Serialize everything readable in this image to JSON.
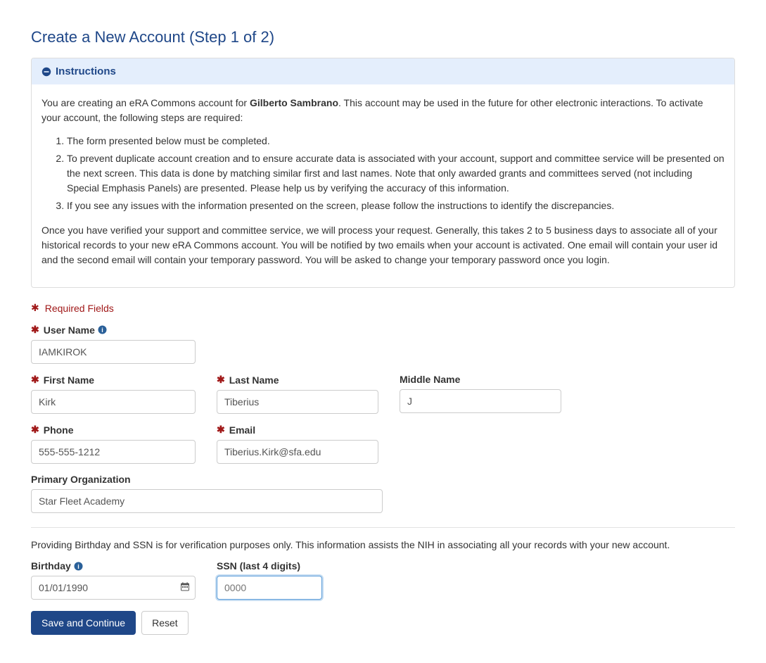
{
  "page_title": "Create a New Account (Step 1 of 2)",
  "instructions": {
    "header": "Instructions",
    "intro_prefix": "You are creating an eRA Commons account for ",
    "bold_name": "Gilberto Sambrano",
    "intro_suffix": ". This account may be used in the future for other electronic interactions. To activate your account, the following steps are required:",
    "steps": [
      "The form presented below must be completed.",
      "To prevent duplicate account creation and to ensure accurate data is associated with your account, support and committee service will be presented on the next screen. This data is done by matching similar first and last names. Note that only awarded grants and committees served (not including Special Emphasis Panels) are presented. Please help us by verifying the accuracy of this information.",
      "If you see any issues with the information presented on the screen, please follow the instructions to identify the discrepancies."
    ],
    "footer": "Once you have verified your support and committee service, we will process your request. Generally, this takes 2 to 5 business days to associate all of your historical records to your new eRA Commons account. You will be notified by two emails when your account is activated. One email will contain your user id and the second email will contain your temporary password. You will be asked to change your temporary password once you login."
  },
  "required_legend": "Required Fields",
  "fields": {
    "username": {
      "label": "User Name",
      "value": "IAMKIROK"
    },
    "first_name": {
      "label": "First Name",
      "value": "Kirk"
    },
    "last_name": {
      "label": "Last Name",
      "value": "Tiberius"
    },
    "middle_name": {
      "label": "Middle Name",
      "value": "J"
    },
    "phone": {
      "label": "Phone",
      "value": "555-555-1212"
    },
    "email": {
      "label": "Email",
      "value": "Tiberius.Kirk@sfa.edu"
    },
    "primary_org": {
      "label": "Primary Organization",
      "value": "Star Fleet Academy"
    },
    "birthday": {
      "label": "Birthday",
      "value": "01/01/1990"
    },
    "ssn": {
      "label": "SSN (last 4 digits)",
      "placeholder": "0000",
      "value": ""
    }
  },
  "verification_help": "Providing Birthday and SSN is for verification purposes only. This information assists the NIH in associating all your records with your new account.",
  "buttons": {
    "save": "Save and Continue",
    "reset": "Reset"
  }
}
